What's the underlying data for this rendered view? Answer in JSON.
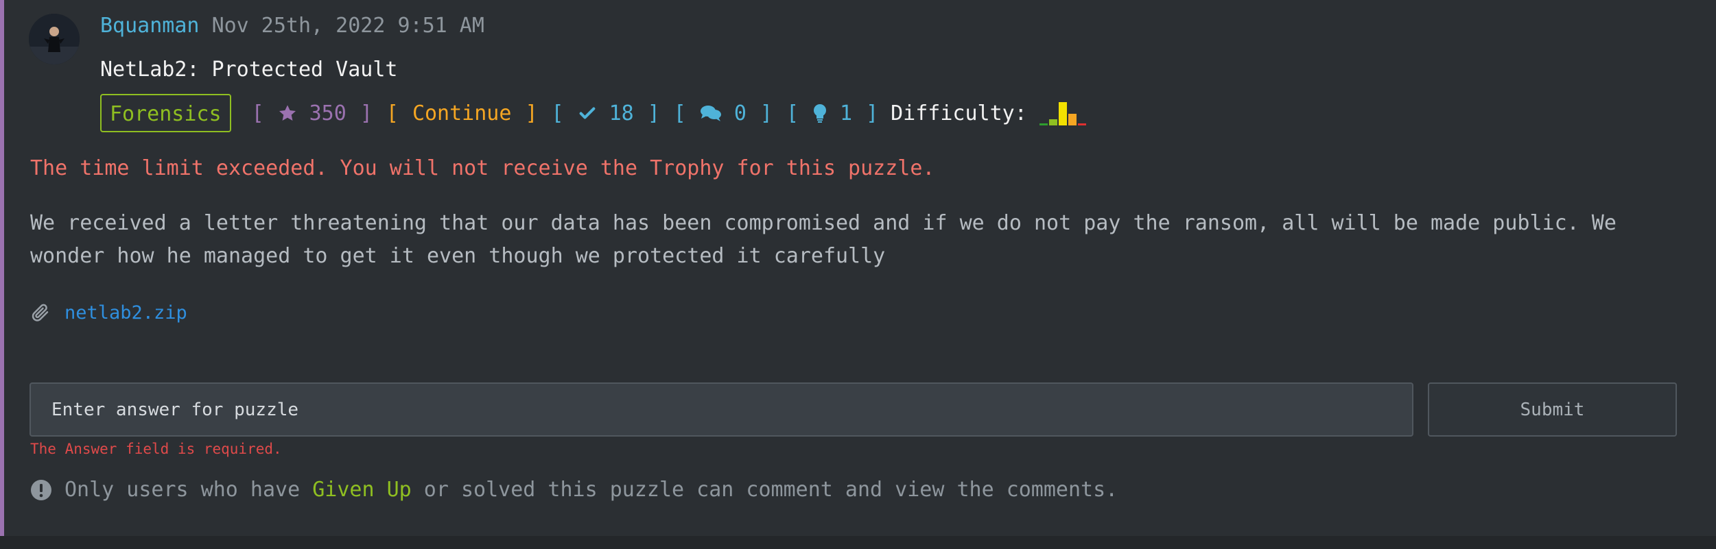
{
  "post": {
    "author": "Bquanman",
    "timestamp": "Nov 25th, 2022 9:51 AM",
    "title": "NetLab2: Protected Vault"
  },
  "meta": {
    "category": "Forensics",
    "points": "350",
    "continue_label": "Continue",
    "solves": "18",
    "comments": "0",
    "hints": "1",
    "difficulty_label": "Difficulty:",
    "bracket_open": "[",
    "bracket_close": "]"
  },
  "difficulty_bars": [
    {
      "color": "#2e9e2e",
      "level": 0.1
    },
    {
      "color": "#8fbf21",
      "level": 0.25
    },
    {
      "color": "#f2e000",
      "level": 1.0
    },
    {
      "color": "#f5a623",
      "level": 0.5
    },
    {
      "color": "#e03030",
      "level": 0.1
    }
  ],
  "warning": "The time limit exceeded. You will not receive the Trophy for this puzzle.",
  "description": "We received a letter threatening that our data has been compromised and if we do not pay the ransom, all will be made public. We wonder how he managed to get it even though we protected it carefully",
  "attachment": {
    "file_name": "netlab2.zip",
    "icon": "paperclip-icon"
  },
  "answer_form": {
    "placeholder": "Enter answer for puzzle",
    "submit_label": "Submit",
    "error": "The Answer field is required."
  },
  "notice": {
    "prefix": "Only users who have",
    "link": "Given Up",
    "suffix": "or solved this puzzle can comment and view the comments.",
    "icon": "exclamation-circle-icon"
  },
  "colors": {
    "accent_border": "#9b72b0",
    "author": "#4fb3d9",
    "category": "#8fbf21",
    "continue": "#f5a623",
    "warning": "#f0736a",
    "link": "#2f8fdf"
  }
}
